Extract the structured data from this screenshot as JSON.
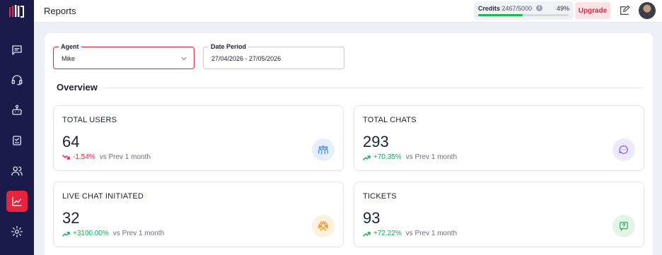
{
  "app": {
    "icons": [
      "logo-icon",
      "chat-icon",
      "headset-icon",
      "bot-icon",
      "tasks-icon",
      "users-icon",
      "reports-icon",
      "settings-icon"
    ]
  },
  "header": {
    "title": "Reports",
    "credits": {
      "label": "Credits",
      "value": "2467/5000",
      "percent_label": "49%",
      "used_fraction": 0.49
    },
    "upgrade_label": "Upgrade"
  },
  "filters": {
    "agent": {
      "label": "Agent",
      "value": "Mike"
    },
    "date_period": {
      "label": "Date Period",
      "value": "27/04/2026 - 27/05/2026"
    }
  },
  "overview": {
    "title": "Overview",
    "cards": [
      {
        "title": "TOTAL USERS",
        "value": "64",
        "change": "-1.54%",
        "direction": "down",
        "suffix": "vs Prev 1 month",
        "icon": "users-group-icon"
      },
      {
        "title": "TOTAL CHATS",
        "value": "293",
        "change": "+70.35%",
        "direction": "up",
        "suffix": "vs Prev 1 month",
        "icon": "chat-bubbles-icon"
      },
      {
        "title": "LIVE CHAT INITIATED",
        "value": "32",
        "change": "+3100.00%",
        "direction": "up",
        "suffix": "vs Prev 1 month",
        "icon": "agent-headset-icon"
      },
      {
        "title": "TICKETS",
        "value": "93",
        "change": "+72.22%",
        "direction": "up",
        "suffix": "vs Prev 1 month",
        "icon": "ticket-question-icon"
      }
    ]
  },
  "colors": {
    "sidebar_bg": "#1b1a4b",
    "accent_red": "#e5243f",
    "trend_up": "#18a957",
    "trend_down": "#e0233a"
  }
}
